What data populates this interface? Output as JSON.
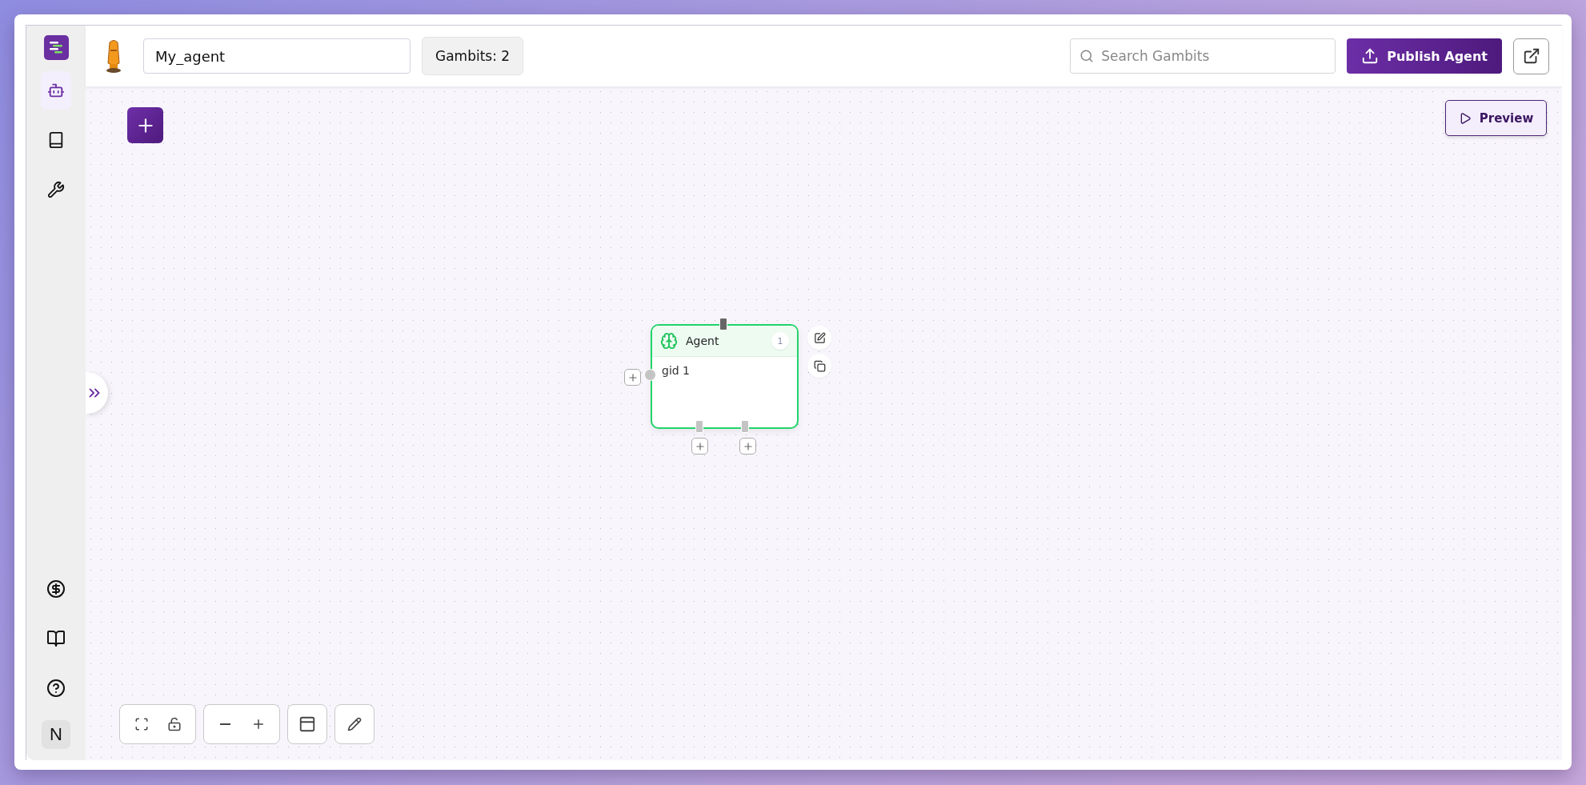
{
  "sidebar": {
    "top_items": [
      {
        "kind": "bot",
        "selected": true
      },
      {
        "kind": "book",
        "selected": false
      },
      {
        "kind": "tool",
        "selected": false
      }
    ],
    "bottom_items": [
      {
        "kind": "billing",
        "selected": false
      },
      {
        "kind": "docs",
        "selected": false
      },
      {
        "kind": "help",
        "selected": false
      }
    ],
    "avatar": "N"
  },
  "header": {
    "agent_name": "My_agent",
    "gambits": "Gambits: 2",
    "search": {
      "placeholder": "Search Gambits"
    },
    "publish": "Publish Agent"
  },
  "canvas": {
    "preview": "Preview",
    "node": {
      "title": "Agent",
      "count": "1",
      "body": "gid 1"
    }
  }
}
